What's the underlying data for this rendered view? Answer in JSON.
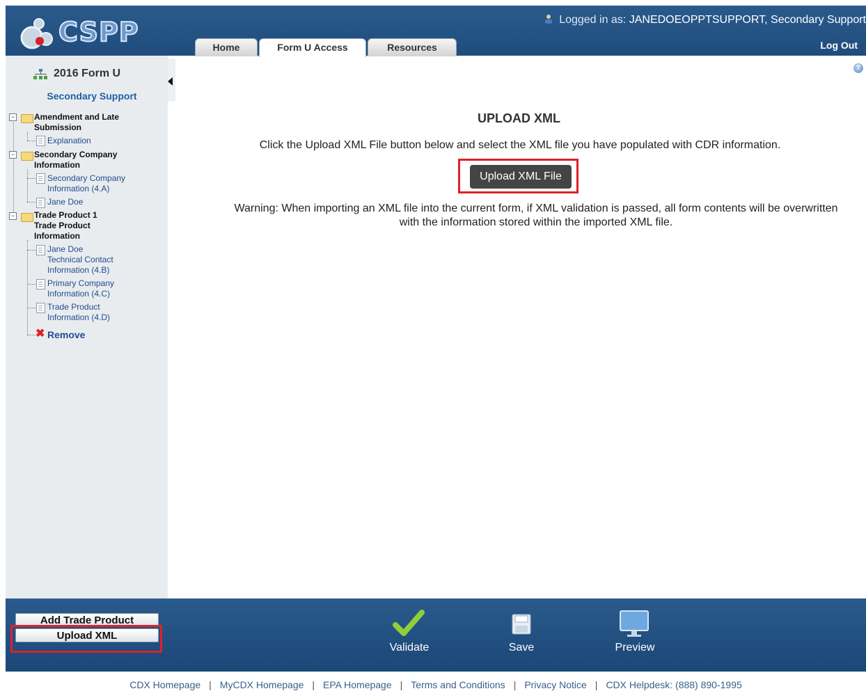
{
  "app": {
    "logo_text": "CSPP"
  },
  "header": {
    "user_prefix": "Logged in as:",
    "user_name": "JANEDOEOPPTSUPPORT, Secondary Support",
    "logout": "Log Out",
    "tabs": [
      "Home",
      "Form U Access",
      "Resources"
    ],
    "active_tab": "Form U Access"
  },
  "sidebar": {
    "form_title": "2016 Form U",
    "role": "Secondary Support",
    "tree": {
      "n1": "Amendment and Late",
      "n1b": "Submission",
      "n1c1": "Explanation",
      "n2": "Secondary Company",
      "n2b": "Information",
      "n2c1a": "Secondary Company",
      "n2c1b": "Information (4.A)",
      "n2c2": "Jane Doe",
      "n3": "Trade Product 1",
      "n3b": "Trade Product",
      "n3c": "Information",
      "n3c1a": "Jane Doe",
      "n3c1b": "Technical Contact",
      "n3c1c": "Information (4.B)",
      "n3c2a": "Primary Company",
      "n3c2b": "Information (4.C)",
      "n3c3a": "Trade Product",
      "n3c3b": "Information (4.D)",
      "remove": "Remove"
    },
    "add_trade_product": "Add Trade Product",
    "upload_xml": "Upload XML"
  },
  "main": {
    "title": "UPLOAD XML",
    "instructions": "Click the Upload XML File button below and select the XML file you have populated with CDR information.",
    "upload_button": "Upload XML File",
    "warning_line1": "Warning: When importing an XML file into the current form, if XML validation is passed, all form contents will be overwritten",
    "warning_line2": "with the information stored within the imported XML file."
  },
  "actions": {
    "validate": "Validate",
    "save": "Save",
    "preview": "Preview"
  },
  "footer": {
    "links": [
      "CDX Homepage",
      "MyCDX Homepage",
      "EPA Homepage",
      "Terms and Conditions",
      "Privacy Notice",
      "CDX Helpdesk: (888) 890-1995"
    ],
    "separator": "|"
  },
  "colors": {
    "header_blue": "#245487",
    "highlight_red": "#e0202a",
    "link_blue": "#214c8f"
  }
}
